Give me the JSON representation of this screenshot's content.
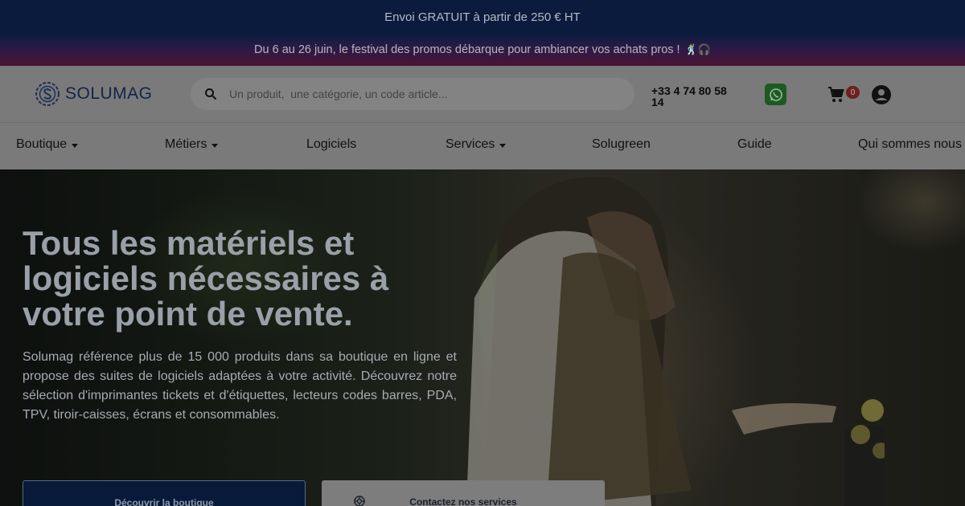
{
  "announcement": {
    "text": "Envoi GRATUIT à partir de 250 € HT"
  },
  "promo": {
    "text": "Du 6 au 26 juin, le festival des promos débarque pour ambiancer vos achats pros !",
    "emoji": "🕺🎧"
  },
  "header": {
    "logo_text": "SOLUMAG",
    "search_placeholder": "Un produit,  une catégorie, un code article...",
    "phone": "+33 4 74 80 58 14",
    "cart_count": "0"
  },
  "nav": {
    "items": [
      {
        "label": "Boutique",
        "dropdown": true
      },
      {
        "label": "Métiers",
        "dropdown": true
      },
      {
        "label": "Logiciels",
        "dropdown": false
      },
      {
        "label": "Services",
        "dropdown": true
      },
      {
        "label": "Solugreen",
        "dropdown": false
      },
      {
        "label": "Guide",
        "dropdown": false
      },
      {
        "label": "Qui sommes nous",
        "dropdown": false
      }
    ]
  },
  "hero": {
    "title": "Tous les matériels et logiciels nécessaires à votre point de vente.",
    "text": "Solumag référence plus de 15 000 produits dans sa boutique en ligne et propose des suites de logiciels adaptées à votre activité. Découvrez notre sélection d'imprimantes tickets et d'étiquettes, lecteurs codes barres, PDA, TPV, tiroir-caisses, écrans et consommables.",
    "primary_button": "Découvrir la boutique",
    "secondary_button": "Contactez nos services"
  },
  "colors": {
    "navy": "#0a1b3d",
    "overlay": "#7a7a7a",
    "whatsapp": "#1d5a23",
    "badge": "#6e1f1f"
  }
}
